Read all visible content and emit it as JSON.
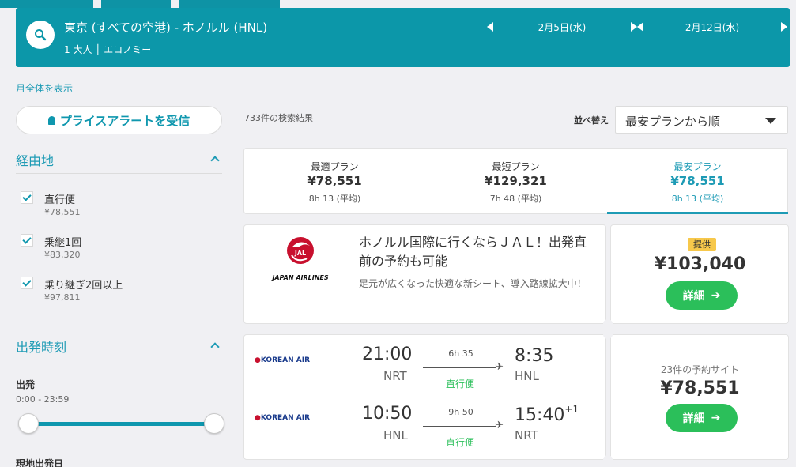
{
  "search": {
    "route": "東京 (すべての空港) - ホノルル (HNL)",
    "passengers": "1 大人 │ エコノミー",
    "depart_date": "2月5日(水)",
    "return_date": "2月12日(水)"
  },
  "sidebar": {
    "month_link": "月全体を表示",
    "price_alert": "プライスアラートを受信",
    "stops_title": "経由地",
    "stops": [
      {
        "label": "直行便",
        "price": "¥78,551"
      },
      {
        "label": "乗継1回",
        "price": "¥83,320"
      },
      {
        "label": "乗り継ぎ2回以上",
        "price": "¥97,811"
      }
    ],
    "times_title": "出発時刻",
    "depart_label": "出発",
    "depart_range": "0:00 - 23:59",
    "local_label": "現地出発日"
  },
  "results": {
    "count": "733件の検索結果",
    "sort_label": "並べ替え",
    "sort_value": "最安プランから順"
  },
  "tabs": [
    {
      "name": "最適プラン",
      "price": "¥78,551",
      "duration": "8h 13 (平均)"
    },
    {
      "name": "最短プラン",
      "price": "¥129,321",
      "duration": "7h 48 (平均)"
    },
    {
      "name": "最安プラン",
      "price": "¥78,551",
      "duration": "8h 13 (平均)"
    }
  ],
  "ad": {
    "airline_logo_text": "JAPAN AIRLINES",
    "logo_mark": "JAL",
    "title": "ホノルル国際に行くならＪＡＬ！出発直前の予約も可能",
    "subtitle": "足元が広くなった快適な新シート、導入路線拡大中！",
    "badge": "提供",
    "price": "¥103,040",
    "button": "詳細"
  },
  "flight": {
    "airline": "KOREAN AIR",
    "outbound": {
      "dep_time": "21:00",
      "dep_apt": "NRT",
      "duration": "6h 35",
      "type": "直行便",
      "arr_time": "8:35",
      "arr_apt": "HNL",
      "day_offset": ""
    },
    "inbound": {
      "dep_time": "10:50",
      "dep_apt": "HNL",
      "duration": "9h 50",
      "type": "直行便",
      "arr_time": "15:40",
      "arr_apt": "NRT",
      "day_offset": "+1"
    },
    "sites": "23件の予約サイト",
    "price": "¥78,551",
    "button": "詳細"
  },
  "colors": {
    "brand": "#0c97a9",
    "accent_green": "#2bbf5a",
    "badge": "#f7c84b"
  }
}
